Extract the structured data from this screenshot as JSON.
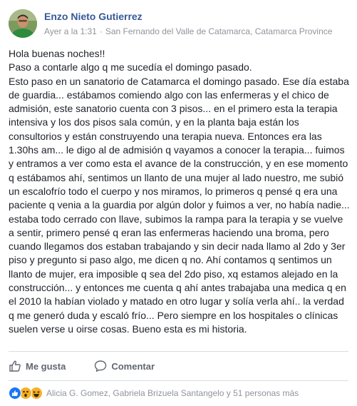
{
  "post": {
    "author": "Enzo Nieto Gutierrez",
    "timestamp": "Ayer a la 1:31",
    "separator": "·",
    "location": "San Fernando del Valle de Catamarca, Catamarca Province",
    "paragraphs": [
      "Hola buenas noches!!",
      "Paso a contarle algo q me sucedía el domingo pasado.",
      "Esto paso en un sanatorio de Catamarca el domingo pasado. Ese día estaba de guardia... estábamos comiendo algo con las enfermeras y el chico de admisión, este sanatorio cuenta con 3 pisos... en el primero esta la terapia intensiva y los dos pisos sala común, y en la planta baja están los consultorios y están construyendo una terapia nueva. Entonces era las 1.30hs am... le digo al de admisión q vayamos a conocer la terapia... fuimos y entramos a ver como esta el avance de la construcción, y en ese momento q estábamos ahí, sentimos un llanto de una mujer al lado nuestro, me subió un escalofrío todo el cuerpo y nos miramos, lo primeros q pensé q era una paciente q venia a la guardia por algún dolor y fuimos a ver, no había nadie... estaba todo cerrado con llave, subimos la rampa para la terapia y se vuelve a sentir, primero pensé q eran las enfermeras haciendo una broma, pero cuando llegamos dos estaban trabajando y sin decir nada llamo al 2do y 3er piso y pregunto si paso algo, me dicen q no. Ahí contamos q sentimos un llanto de mujer, era imposible q sea del 2do piso, xq estamos alejado en la construcción... y entonces me cuenta q ahí antes trabajaba una medica q en el 2010 la habían violado y matado en otro lugar y solía verla ahí.. la verdad q me generó duda y escaló frío... Pero siempre en los hospitales o clínicas suelen verse u oirse cosas. Bueno esta es mi historia."
    ]
  },
  "actions": {
    "like_label": "Me gusta",
    "comment_label": "Comentar"
  },
  "reactions": {
    "icons": [
      "like-icon",
      "wow-icon",
      "haha-icon"
    ],
    "summary": "Alicia G. Gomez, Gabriela Brizuela Santangelo y 51 personas más"
  },
  "colors": {
    "author_link": "#365899",
    "secondary_text": "#90949c",
    "like_blue": "#1877f2",
    "emoji_yellow": "#f7b125"
  }
}
